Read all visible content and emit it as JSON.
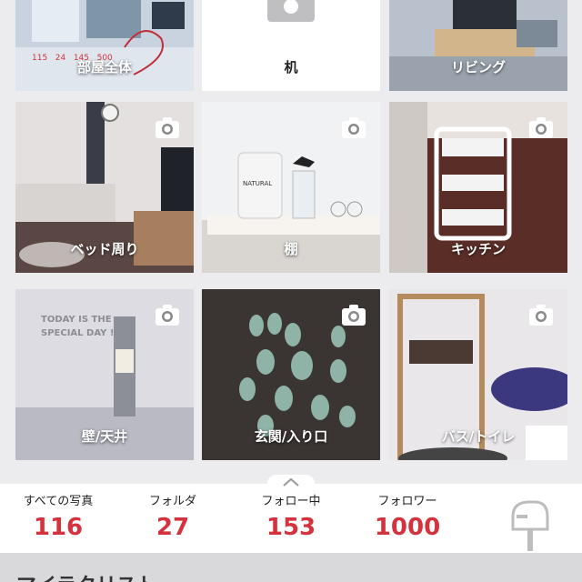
{
  "tiles": [
    {
      "label": "部屋全体"
    },
    {
      "label": "机"
    },
    {
      "label": "リビング"
    },
    {
      "label": "ベッド周り"
    },
    {
      "label": "棚"
    },
    {
      "label": "キッチン"
    },
    {
      "label": "壁/天井"
    },
    {
      "label": "玄関/入り口"
    },
    {
      "label": "バス/トイレ"
    }
  ],
  "thumb_text": {
    "room_stats": [
      "115",
      "24",
      "145",
      "500"
    ],
    "wall_text": "TODAY IS THE SPECIAL DAY !",
    "shelf_text": "NATURAL"
  },
  "stats": {
    "photos": {
      "label": "すべての写真",
      "value": "116"
    },
    "folders": {
      "label": "フォルダ",
      "value": "27"
    },
    "following": {
      "label": "フォロー中",
      "value": "153"
    },
    "followers": {
      "label": "フォロワー",
      "value": "1000"
    }
  },
  "bottom": {
    "title": "マイラクリスト"
  },
  "colors": {
    "accent": "#d4323c"
  }
}
